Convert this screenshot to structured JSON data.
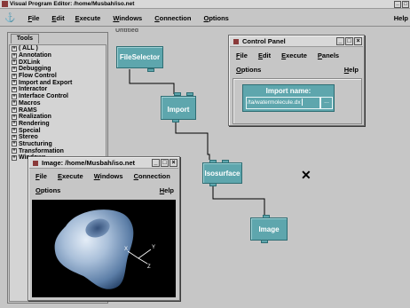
{
  "main_window": {
    "title": "Visual Program Editor: /home/Musbah/iso.net",
    "menu": [
      "File",
      "Edit",
      "Execute",
      "Windows",
      "Connection",
      "Options"
    ],
    "help": "Help",
    "title_buttons": [
      "_",
      "□"
    ]
  },
  "tools": {
    "tab_label": "Tools",
    "items": [
      "( ALL )",
      "Annotation",
      "DXLink",
      "Debugging",
      "Flow Control",
      "Import and Export",
      "Interactor",
      "Interface Control",
      "Macros",
      "RAMS",
      "Realization",
      "Rendering",
      "Special",
      "Stereo",
      "Structuring",
      "Transformation",
      "Windows"
    ]
  },
  "canvas": {
    "page_tab": "Untitled",
    "modules": {
      "fileselector": "FileSelector",
      "import": "Import",
      "isosurface": "Isosurface",
      "image": "Image"
    }
  },
  "control_panel": {
    "title": "Control Panel",
    "menu": [
      "File",
      "Edit",
      "Execute",
      "Panels"
    ],
    "options": "Options",
    "help": "Help",
    "interactor_label": "Import name:",
    "interactor_value": "/ta/watermolecule.dx",
    "browse_button": "...",
    "title_buttons": [
      "_",
      "□",
      "×"
    ]
  },
  "image_window": {
    "title": "Image: /home/Musbah/iso.net",
    "menu": [
      "File",
      "Execute",
      "Windows",
      "Connection"
    ],
    "options": "Options",
    "help": "Help",
    "title_buttons": [
      "_",
      "□",
      "×"
    ],
    "axis_labels": [
      "X",
      "Y",
      "Z"
    ]
  },
  "colors": {
    "module": "#5ea6ad",
    "titlebar_active": "#2f3f8a",
    "background": "#c6c6c6"
  },
  "icons": [
    "program-icon",
    "minimize-icon",
    "maximize-icon",
    "close-icon",
    "cursor-x-icon"
  ]
}
